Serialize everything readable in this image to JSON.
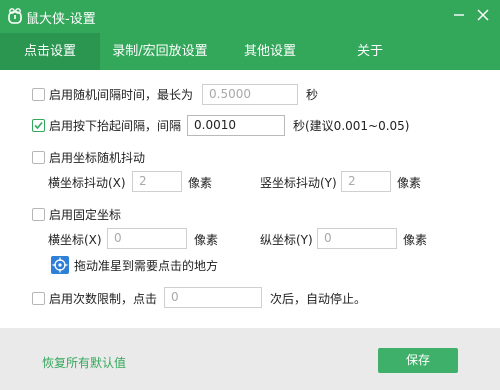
{
  "window": {
    "title": "鼠大侠-设置"
  },
  "tabs": [
    {
      "label": "点击设置",
      "active": true
    },
    {
      "label": "录制/宏回放设置",
      "active": false
    },
    {
      "label": "其他设置",
      "active": false
    },
    {
      "label": "关于",
      "active": false
    }
  ],
  "random_interval": {
    "checked": false,
    "label": "启用随机间隔时间，最长为",
    "value": "0.5000",
    "unit": "秒"
  },
  "press_interval": {
    "checked": true,
    "label": "启用按下抬起间隔，间隔",
    "value": "0.0010",
    "unit": "秒(建议0.001~0.05)"
  },
  "coord_jitter": {
    "checked": false,
    "label": "启用坐标随机抖动",
    "x_label": "横坐标抖动(X)",
    "x_value": "2",
    "x_unit": "像素",
    "y_label": "竖坐标抖动(Y)",
    "y_value": "2",
    "y_unit": "像素"
  },
  "fixed_coord": {
    "checked": false,
    "label": "启用固定坐标",
    "x_label": "横坐标(X)",
    "x_value": "0",
    "x_unit": "像素",
    "y_label": "纵坐标(Y)",
    "y_value": "0",
    "y_unit": "像素",
    "drag_hint": "拖动准星到需要点击的地方"
  },
  "click_limit": {
    "checked": false,
    "label": "启用次数限制，点击",
    "value": "0",
    "suffix": "次后，自动停止。"
  },
  "footer": {
    "reset_label": "恢复所有默认值",
    "save_label": "保存"
  },
  "colors": {
    "brand": "#33a85b",
    "tab_active": "#2b9650",
    "footer_bg": "#eaeaea"
  }
}
